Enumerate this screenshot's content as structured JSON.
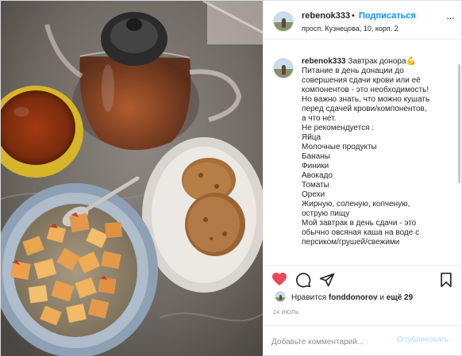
{
  "post": {
    "username": "rebenok333",
    "dot": "•",
    "follow_label": "Подписаться",
    "location": "просп. Кузнецова, 10, корп. 2",
    "more_label": "···",
    "caption": {
      "username": "rebenok333",
      "first_line_text": " Завтрак донора💪",
      "lines": [
        "Питание в день донации до",
        "совершения сдачи крови или её",
        "компонентов - это необходимость!",
        "Но важно знать, что можно кушать",
        "перед сдачей крови/компонентов,",
        "а что нет.",
        "Не рекомендуется :",
        "Яйца",
        "Молочные продукты",
        "Бананы",
        "Финики",
        "Авокадо",
        "Томаты",
        "Орехи",
        "Жирную, соленую, копченую,",
        "острую пищу",
        "Мой завтрак в день сдачи - это",
        "обычно овсяная каша на воде с",
        "персиком/грушей/свежими"
      ]
    },
    "likes": {
      "prefix": "Нравится ",
      "user": "fonddonorov",
      "middle": " и ",
      "others": "ещё 29"
    },
    "date": "24 ИЮЛЬ",
    "comment_placeholder": "Добавьте комментарий...",
    "publish_label": "Опубликовать",
    "icons": {
      "heart": "heart-icon",
      "comment": "comment-icon",
      "share": "share-icon",
      "bookmark": "bookmark-icon",
      "more": "more-icon"
    },
    "colors": {
      "like_red": "#ed4956",
      "link_blue": "#0095f6",
      "publish_disabled": "#b2dffc",
      "muted_gray": "#8e8e8e"
    }
  }
}
